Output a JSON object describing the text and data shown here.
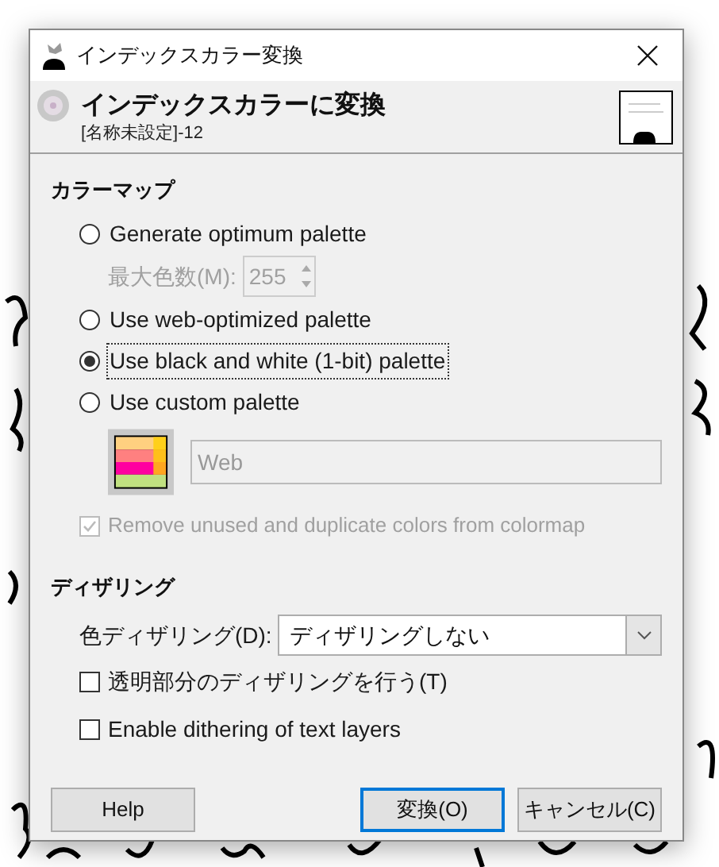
{
  "window": {
    "title": "インデックスカラー変換"
  },
  "header": {
    "title": "インデックスカラーに変換",
    "subtitle": "[名称未設定]-12"
  },
  "colormap": {
    "heading": "カラーマップ",
    "options": [
      {
        "label": "Generate optimum palette",
        "selected": false
      },
      {
        "label": "Use web-optimized palette",
        "selected": false
      },
      {
        "label": "Use black and white (1-bit) palette",
        "selected": true
      },
      {
        "label": "Use custom palette",
        "selected": false
      }
    ],
    "max_colors": {
      "label": "最大色数(M):",
      "value": "255",
      "disabled": true
    },
    "custom_palette": {
      "value": "Web",
      "disabled": true
    },
    "remove_unused": {
      "label": "Remove unused and duplicate colors from colormap",
      "checked": true,
      "disabled": true
    }
  },
  "dithering": {
    "heading": "ディザリング",
    "color_dithering": {
      "label": "色ディザリング(D):",
      "value": "ディザリングしない"
    },
    "checkboxes": [
      {
        "label": "透明部分のディザリングを行う(T)",
        "checked": false
      },
      {
        "label": "Enable dithering of text layers",
        "checked": false
      }
    ]
  },
  "buttons": [
    {
      "label": "Help",
      "kind": "help"
    },
    {
      "label": "変換(O)",
      "kind": "default"
    },
    {
      "label": "キャンセル(C)",
      "kind": "normal"
    }
  ]
}
